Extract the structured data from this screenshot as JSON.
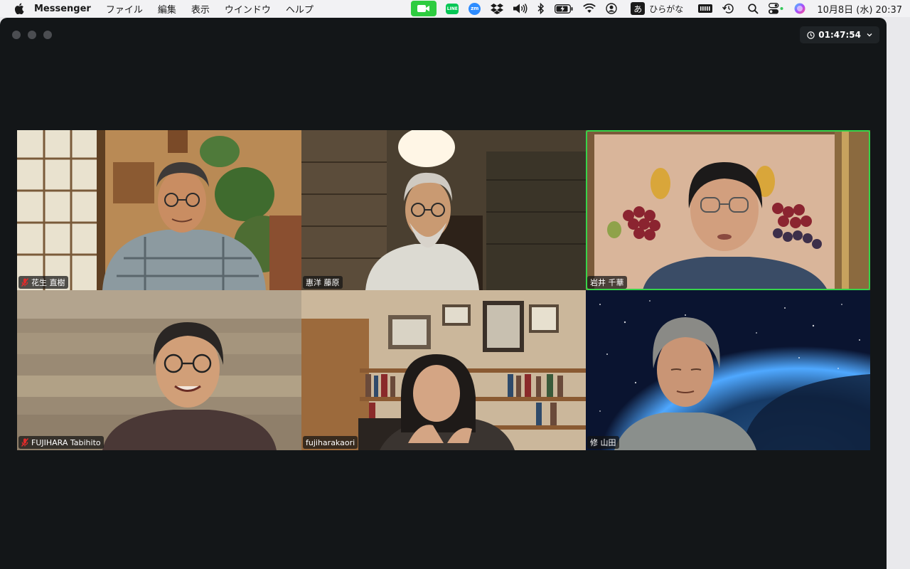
{
  "menubar": {
    "app_name": "Messenger",
    "menus": [
      "ファイル",
      "編集",
      "表示",
      "ウインドウ",
      "ヘルプ"
    ],
    "status_icons": [
      "zoom-camera-icon",
      "line-icon",
      "zoom-icon",
      "dropbox-icon",
      "volume-icon",
      "bluetooth-icon",
      "battery-icon",
      "wifi-icon",
      "user-account-icon",
      "input-method-icon",
      "keyboard-icon",
      "time-machine-icon",
      "search-icon",
      "control-center-icon",
      "siri-icon"
    ],
    "line_label": "LINE",
    "zoom_label": "zm",
    "ime_glyph": "あ",
    "ime_label": "ひらがな",
    "clock": "10月8日 (水)  20:37"
  },
  "meeting": {
    "elapsed": "01:47:54",
    "colors": {
      "active_speaker_border": "#37d44a",
      "muted_mic": "#e02b2b",
      "window_bg": "#131618"
    },
    "participants": [
      {
        "name": "花生 直樹",
        "muted": true,
        "active": false
      },
      {
        "name": "惠洋 藤原",
        "muted": false,
        "active": false
      },
      {
        "name": "岩井 千華",
        "muted": false,
        "active": true
      },
      {
        "name": "FUJIHARA Tabihito",
        "muted": true,
        "active": false
      },
      {
        "name": "fujiharakaori",
        "muted": false,
        "active": false
      },
      {
        "name": "修 山田",
        "muted": false,
        "active": false
      }
    ]
  }
}
